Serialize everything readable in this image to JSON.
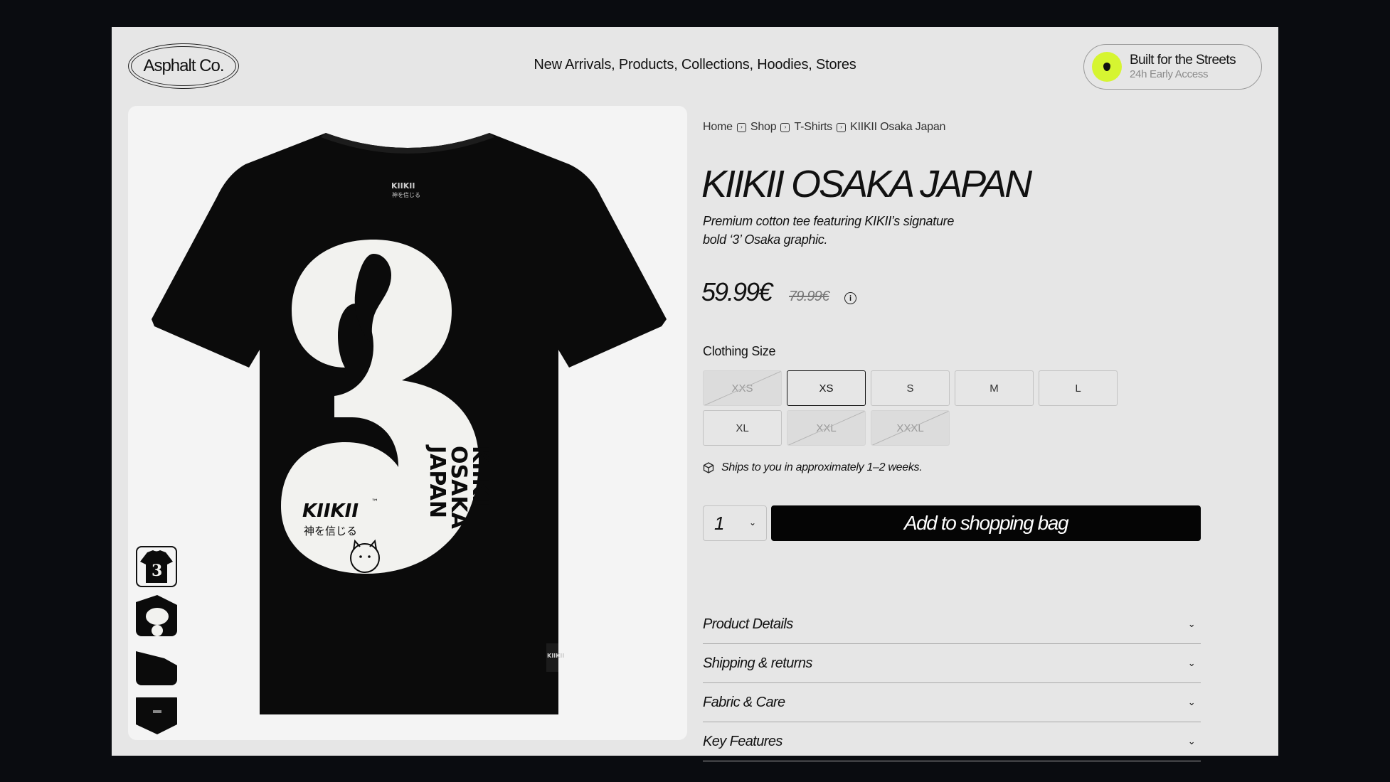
{
  "brand": {
    "logo": "Asphalt Co."
  },
  "nav": {
    "items": [
      "New Arrivals",
      "Products",
      "Collections",
      "Hoodies",
      "Stores"
    ],
    "separator": ", "
  },
  "promo": {
    "title": "Built for the Streets",
    "subtitle": "24h Early Access",
    "accent": "#d6f531"
  },
  "breadcrumb": [
    "Home",
    "Shop",
    "T-Shirts",
    "KIIKII Osaka Japan"
  ],
  "product": {
    "title": "KIIKII OSAKA JAPAN",
    "description": "Premium cotton tee featuring KIKII’s signature bold ‘3’ Osaka graphic.",
    "price": "59.99€",
    "old_price": "79.99€",
    "size_label": "Clothing Size",
    "sizes": [
      {
        "label": "XXS",
        "state": "unavailable"
      },
      {
        "label": "XS",
        "state": "selected"
      },
      {
        "label": "S",
        "state": "available"
      },
      {
        "label": "M",
        "state": "available"
      },
      {
        "label": "L",
        "state": "available"
      },
      {
        "label": "XL",
        "state": "available"
      },
      {
        "label": "XXL",
        "state": "unavailable"
      },
      {
        "label": "XXXL",
        "state": "unavailable"
      }
    ],
    "shipping": "Ships to you in approximately 1–2 weeks.",
    "quantity": "1",
    "add_to_bag": "Add to shopping bag"
  },
  "graphic": {
    "shirt_brand": "KIIKII",
    "tm": "™",
    "japanese": "神を信じる",
    "number": "3",
    "side_text": [
      "KIIKII",
      "OSAKA",
      "JAPAN"
    ],
    "tag_brand": "KIIKII",
    "shirt_color": "#0b0b0b",
    "print_color": "#f2f2ef"
  },
  "accordion": [
    "Product Details",
    "Shipping & returns",
    "Fabric & Care",
    "Key Features"
  ]
}
